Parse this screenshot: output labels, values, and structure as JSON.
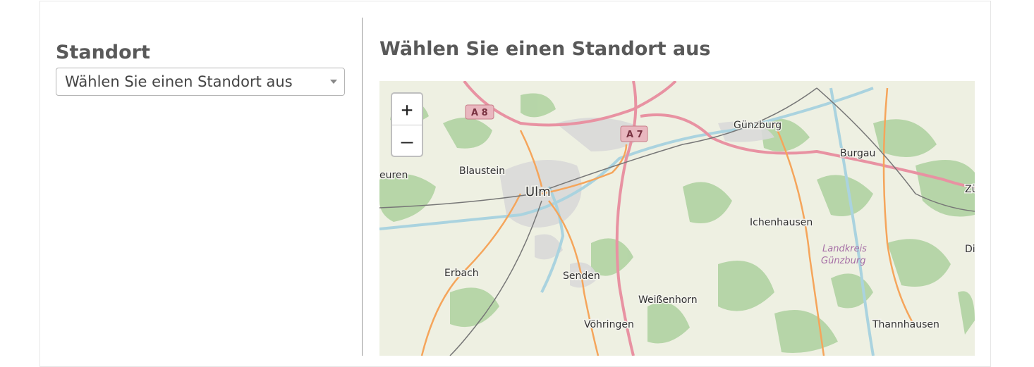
{
  "form": {
    "label": "Standort",
    "select_value": "Wählen Sie einen Standort aus"
  },
  "map_panel": {
    "title": "Wählen Sie einen Standort aus",
    "zoom_in": "+",
    "zoom_out": "–"
  },
  "map": {
    "highways": [
      "A 8",
      "A 7"
    ],
    "places": {
      "ulm": "Ulm",
      "blaustein": "Blaustein",
      "eurenText": "euren",
      "guenzburg": "Günzburg",
      "burgau": "Burgau",
      "zu": "Zü",
      "ichenhausen": "Ichenhausen",
      "landkreis1": "Landkreis",
      "landkreis2": "Günzburg",
      "di": "Di",
      "erbach": "Erbach",
      "senden": "Senden",
      "weissenhorn": "Weißenhorn",
      "voehringen": "Vöhringen",
      "thannhausen": "Thannhausen"
    },
    "colors": {
      "land": "#eef0e2",
      "forest": "#add19e",
      "water": "#aad3df",
      "motorway": "#e892a2",
      "primary": "#f5a55b",
      "urban": "#d9d9d9"
    }
  }
}
